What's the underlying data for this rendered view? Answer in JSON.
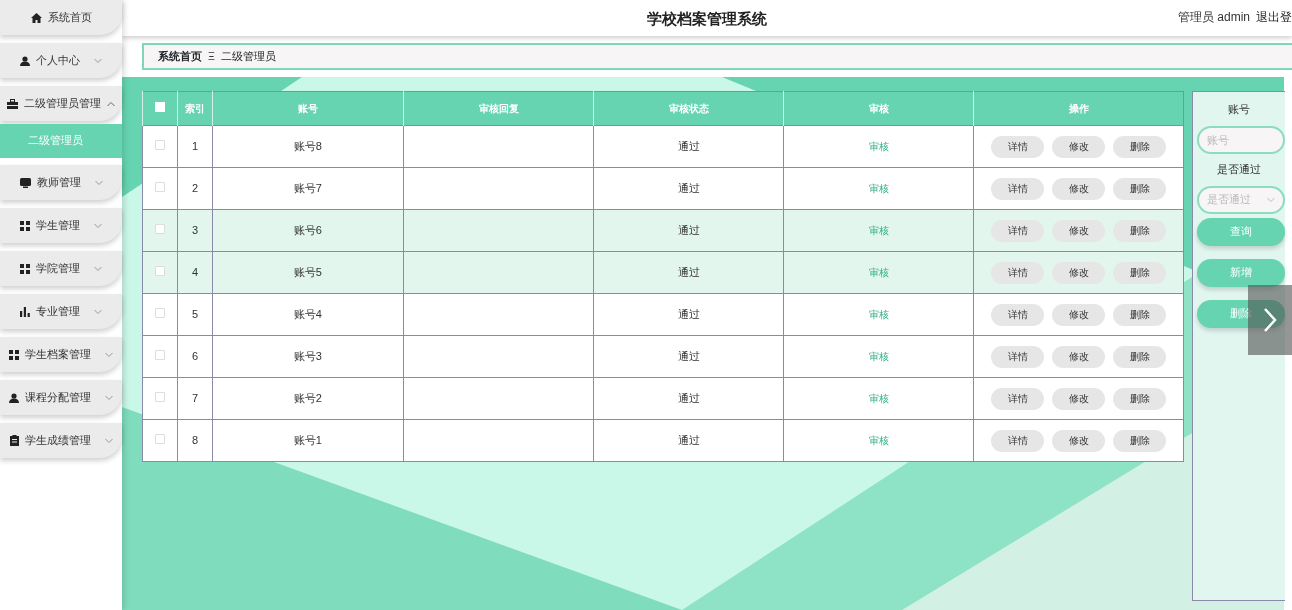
{
  "sidebar": {
    "items": [
      {
        "label": "系统首页"
      },
      {
        "label": "个人中心",
        "expanded": false
      },
      {
        "label": "二级管理员管理",
        "expanded": true,
        "children": [
          {
            "label": "二级管理员",
            "selected": true
          }
        ]
      },
      {
        "label": "教师管理",
        "expanded": false
      },
      {
        "label": "学生管理",
        "expanded": false
      },
      {
        "label": "学院管理",
        "expanded": false
      },
      {
        "label": "专业管理",
        "expanded": false
      },
      {
        "label": "学生档案管理",
        "expanded": false
      },
      {
        "label": "课程分配管理",
        "expanded": false
      },
      {
        "label": "学生成绩管理",
        "expanded": false
      }
    ]
  },
  "header": {
    "title": "学校档案管理系统",
    "user": "管理员 admin",
    "logout": "退出登"
  },
  "breadcrumb": {
    "items": [
      "系统首页",
      "二级管理员"
    ],
    "separator": "Ξ"
  },
  "table": {
    "select_all": false,
    "columns": [
      "索引",
      "账号",
      "审核回复",
      "审核状态",
      "审核",
      "操作"
    ],
    "rows": [
      {
        "checked": false,
        "highlighted": false,
        "index": "1",
        "account": "账号8",
        "status": "通过",
        "review": "审核",
        "actions": [
          "详情",
          "修改",
          "删除"
        ]
      },
      {
        "checked": false,
        "highlighted": false,
        "index": "2",
        "account": "账号7",
        "status": "通过",
        "review": "审核",
        "actions": [
          "详情",
          "修改",
          "删除"
        ]
      },
      {
        "checked": false,
        "highlighted": true,
        "index": "3",
        "account": "账号6",
        "status": "通过",
        "review": "审核",
        "actions": [
          "详情",
          "修改",
          "删除"
        ]
      },
      {
        "checked": false,
        "highlighted": true,
        "index": "4",
        "account": "账号5",
        "status": "通过",
        "review": "审核",
        "actions": [
          "详情",
          "修改",
          "删除"
        ]
      },
      {
        "checked": false,
        "highlighted": false,
        "index": "5",
        "account": "账号4",
        "status": "通过",
        "review": "审核",
        "actions": [
          "详情",
          "修改",
          "删除"
        ]
      },
      {
        "checked": false,
        "highlighted": false,
        "index": "6",
        "account": "账号3",
        "status": "通过",
        "review": "审核",
        "actions": [
          "详情",
          "修改",
          "删除"
        ]
      },
      {
        "checked": false,
        "highlighted": false,
        "index": "7",
        "account": "账号2",
        "status": "通过",
        "review": "审核",
        "actions": [
          "详情",
          "修改",
          "删除"
        ]
      },
      {
        "checked": false,
        "highlighted": false,
        "index": "8",
        "account": "账号1",
        "status": "通过",
        "review": "审核",
        "actions": [
          "详情",
          "修改",
          "删除"
        ]
      }
    ]
  },
  "search_panel": {
    "account_label": "账号",
    "account_placeholder": "账号",
    "pass_label": "是否通过",
    "pass_placeholder": "是否通过",
    "buttons": [
      "查询",
      "新增",
      "删除"
    ]
  }
}
